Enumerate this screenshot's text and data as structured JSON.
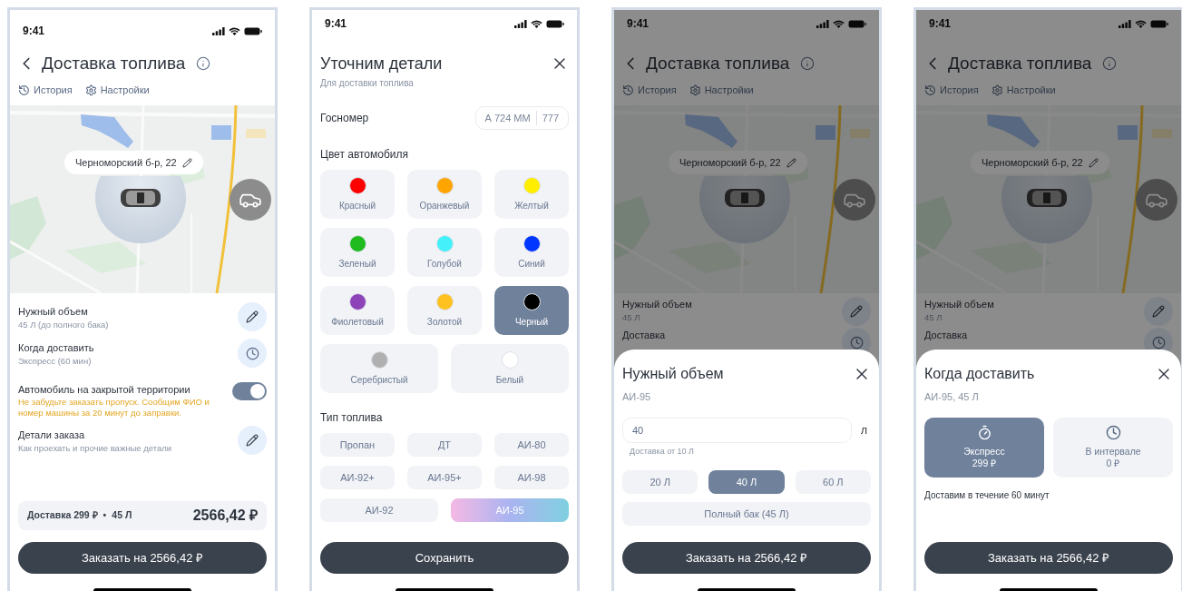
{
  "phones": [
    {
      "kind": "main",
      "time": "9:41",
      "title": "Доставка топлива",
      "links": [
        {
          "kind": "history",
          "label": "История"
        },
        {
          "kind": "settings",
          "label": "Настройки"
        }
      ],
      "address": "Черноморский б-р, 22",
      "rows": [
        {
          "kind": "edit",
          "title": "Нужный объем",
          "subtitle": "45 Л (до полного бака)"
        },
        {
          "kind": "time",
          "title": "Когда доставить",
          "subtitle": "Экспресс (60 мин)"
        },
        {
          "kind": "toggle",
          "title": "Автомобиль на закрытой территории",
          "note": "Не забудьте заказать пропуск. Сообщим ФИО и номер машины за 20 минут до заправки.",
          "on": true
        },
        {
          "kind": "edit",
          "title": "Детали заказа",
          "subtitle": "Как проехать и прочие важные детали"
        }
      ],
      "summary": {
        "delivery": "Доставка 299 ₽",
        "separator": "•",
        "volume": "45 Л",
        "total": "2566,42 ₽"
      },
      "primary_button": "Заказать на 2566,42 ₽"
    },
    {
      "kind": "details",
      "time": "9:41",
      "title": "Уточним детали",
      "subtitle": "Для доставки топлива",
      "plate": {
        "label": "Госномер",
        "number": "А 724 ММ",
        "region": "777"
      },
      "colors_label": "Цвет автомобиля",
      "colors": [
        {
          "label": "Красный",
          "color": "#ff0000",
          "selected": false
        },
        {
          "label": "Оранжевый",
          "color": "#ffa500",
          "selected": false
        },
        {
          "label": "Желтый",
          "color": "#ffee00",
          "selected": false
        },
        {
          "label": "Зеленый",
          "color": "#1fbb1f",
          "selected": false
        },
        {
          "label": "Голубой",
          "color": "#44f0fa",
          "selected": false
        },
        {
          "label": "Синий",
          "color": "#0036ff",
          "selected": false
        },
        {
          "label": "Фиолетовый",
          "color": "#8c44b8",
          "selected": false
        },
        {
          "label": "Золотой",
          "color": "#ffc11f",
          "selected": false
        },
        {
          "label": "Черный",
          "color": "#000000",
          "selected": true
        },
        {
          "label": "Серебристый",
          "color": "#b0b0b0",
          "selected": false
        },
        {
          "label": "Белый",
          "color": "#ffffff",
          "selected": false
        }
      ],
      "fuel_label": "Тип топлива",
      "fuels": [
        {
          "label": "Пропан",
          "selected": false
        },
        {
          "label": "ДТ",
          "selected": false
        },
        {
          "label": "АИ-80",
          "selected": false
        },
        {
          "label": "АИ-92+",
          "selected": false
        },
        {
          "label": "АИ-95+",
          "selected": false
        },
        {
          "label": "АИ-98",
          "selected": false
        },
        {
          "label": "АИ-92",
          "selected": false
        },
        {
          "label": "АИ-95",
          "selected": true
        }
      ],
      "primary_button": "Сохранить"
    },
    {
      "kind": "volume_sheet",
      "background": {
        "time": "9:41",
        "title": "Доставка топлива",
        "links": [
          {
            "kind": "history",
            "label": "История"
          },
          {
            "kind": "settings",
            "label": "Настройки"
          }
        ],
        "address": "Черноморский б-р, 22",
        "rows": [
          {
            "kind": "edit",
            "title": "Нужный объем",
            "subtitle": "45 Л"
          },
          {
            "kind": "time",
            "title": "Доставка"
          }
        ]
      },
      "sheet": {
        "title": "Нужный объем",
        "subtitle": "АИ-95",
        "input": {
          "value": "40",
          "unit": "л",
          "hint": "Доставка от 10 Л"
        },
        "options": [
          {
            "kind": "preset",
            "label": "20 Л",
            "selected": false
          },
          {
            "kind": "preset",
            "label": "40 Л",
            "selected": true
          },
          {
            "kind": "preset",
            "label": "60 Л",
            "selected": false
          },
          {
            "kind": "full",
            "label": "Полный бак (45 Л)",
            "selected": false
          }
        ]
      },
      "primary_button": "Заказать на 2566,42 ₽"
    },
    {
      "kind": "delivery_sheet",
      "background": {
        "time": "9:41",
        "title": "Доставка топлива",
        "links": [
          {
            "kind": "history",
            "label": "История"
          },
          {
            "kind": "settings",
            "label": "Настройки"
          }
        ],
        "address": "Черноморский б-р, 22",
        "rows": [
          {
            "kind": "edit",
            "title": "Нужный объем",
            "subtitle": "45 Л"
          },
          {
            "kind": "time",
            "title": "Доставка"
          }
        ]
      },
      "sheet": {
        "title": "Когда доставить",
        "subtitle": "АИ-95, 45 Л",
        "options": [
          {
            "kind": "express",
            "title": "Экспресс",
            "price": "299 ₽",
            "selected": true
          },
          {
            "kind": "interval",
            "title": "В интервале",
            "price": "0 ₽",
            "selected": false
          }
        ],
        "note": "Доставим в течение 60 минут"
      },
      "primary_button": "Заказать на 2566,42 ₽"
    }
  ]
}
